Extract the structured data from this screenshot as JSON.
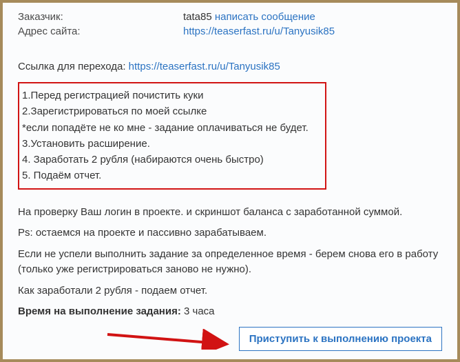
{
  "info": {
    "customer_label": "Заказчик:",
    "customer_value": "tata85",
    "customer_action": "написать сообщение",
    "site_label": "Адрес сайта:",
    "site_url": "https://teaserfast.ru/u/Tanyusik85"
  },
  "transition": {
    "label": "Ссылка для перехода: ",
    "url": "https://teaserfast.ru/u/Tanyusik85"
  },
  "steps": [
    "1.Перед регистрацией почистить куки",
    "2.Зарегистрироваться по моей ссылке",
    "*если попадёте не ко мне - задание оплачиваться не будет.",
    "3.Установить расширение.",
    "4. Заработать 2 рубля (набираются очень быстро)",
    "5. Подаём отчет."
  ],
  "notes": {
    "p1": "На проверку Ваш логин в проекте. и скриншот баланса с заработанной суммой.",
    "p2": "Ps: остаемся на проекте и пассивно зарабатываем.",
    "p3": "Если не успели выполнить задание за определенное время - берем снова его в работу (только уже регистрироваться заново не нужно).",
    "p4": "Как заработали 2 рубля - подаем отчет.",
    "time_label": "Время на выполнение задания:",
    "time_value": " 3 часа"
  },
  "action_button": "Приступить к выполнению проекта"
}
